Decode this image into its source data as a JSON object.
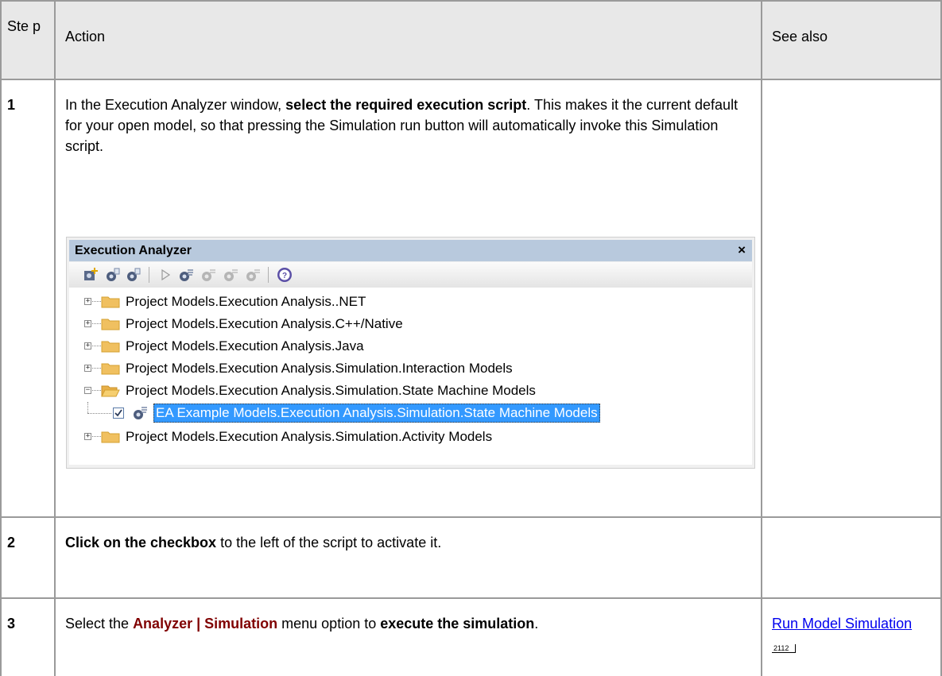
{
  "table": {
    "headers": {
      "step": "Ste p",
      "action": "Action",
      "see_also": "See also"
    },
    "rows": [
      {
        "step": "1",
        "action_parts": {
          "a": "In the Execution Analyzer window, ",
          "b": "select the required execution script",
          "c": ". This makes it the current default for your open model, so that pressing the Simulation run button will automatically invoke this Simulation script."
        },
        "see_also": ""
      },
      {
        "step": "2",
        "action_parts": {
          "a": "Click on the checkbox",
          "b": " to the left of the script to activate it."
        },
        "see_also": ""
      },
      {
        "step": "3",
        "action_parts": {
          "a": "Select the ",
          "b": "Analyzer | Simulation",
          "c": " menu option to ",
          "d": "execute the simulation",
          "e": "."
        },
        "see_also": {
          "link": "Run Model Simulation",
          "page": "2112"
        }
      }
    ]
  },
  "window": {
    "title": "Execution Analyzer",
    "close": "×",
    "toolbar_icons": [
      "new-script-icon",
      "edit-script-icon",
      "copy-script-icon",
      "run-icon",
      "build-icon",
      "test-icon",
      "deploy-icon",
      "stop-icon",
      "help-icon"
    ],
    "tree": [
      {
        "label": "Project Models.Execution Analysis..NET",
        "expanded": false
      },
      {
        "label": "Project Models.Execution Analysis.C++/Native",
        "expanded": false
      },
      {
        "label": "Project Models.Execution Analysis.Java",
        "expanded": false
      },
      {
        "label": "Project Models.Execution Analysis.Simulation.Interaction Models",
        "expanded": false
      },
      {
        "label": "Project Models.Execution Analysis.Simulation.State Machine Models",
        "expanded": true
      },
      {
        "label": "EA Example Models.Execution Analysis.Simulation.State Machine Models",
        "checked": true,
        "selected": true
      },
      {
        "label": "Project Models.Execution Analysis.Simulation.Activity Models",
        "expanded": false
      }
    ]
  },
  "colors": {
    "link": "#0000ee",
    "menu": "#800000",
    "selection": "#3399ff",
    "title_bar": "#b8c9dd"
  }
}
